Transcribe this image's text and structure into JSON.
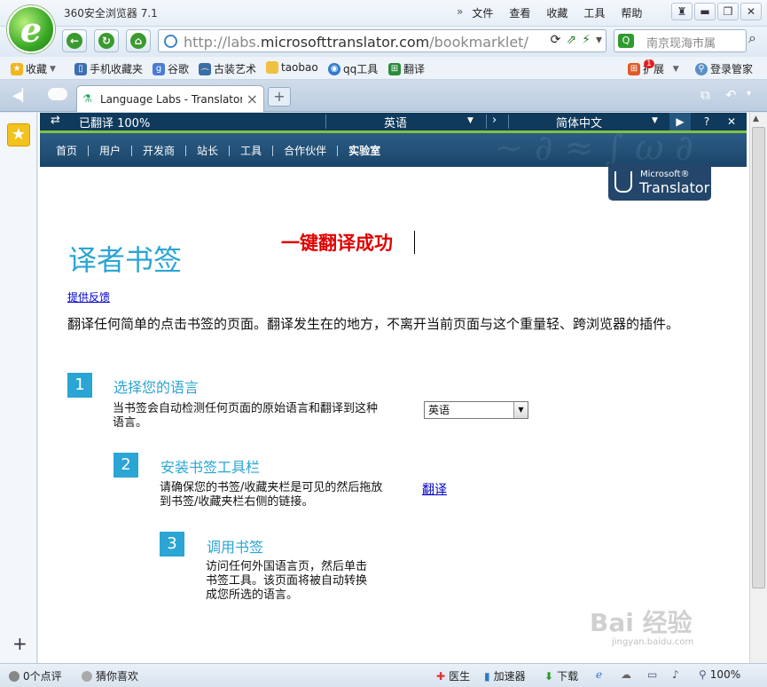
{
  "browser": {
    "title": "360安全浏览器 7.1",
    "menus": [
      "文件",
      "查看",
      "收藏",
      "工具",
      "帮助"
    ],
    "url_prefix": "http://labs.",
    "url_domain": "microsofttranslator.com",
    "url_path": "/bookmarklet/",
    "search_placeholder": "南京现海市属",
    "logo_letter": "e"
  },
  "bookmarks": {
    "favorites": "收藏",
    "mobile": "手机收藏夹",
    "google": "谷歌",
    "guzhuang": "古装艺术",
    "taobao": "taobao",
    "qq": "qq工具",
    "translate": "翻译",
    "extend": "扩展",
    "extend_badge": "1",
    "login": "登录管家"
  },
  "tab": {
    "label": "Language Labs - Translator"
  },
  "translator_bar": {
    "status": "已翻译 100%",
    "from_lang": "英语",
    "to_lang": "简体中文",
    "help": "?",
    "close": "✕"
  },
  "site_nav": [
    "首页",
    "用户",
    "开发商",
    "站长",
    "工具",
    "合作伙伴",
    "实验室"
  ],
  "badge": {
    "ms": "Microsoft®",
    "tr": "Translator"
  },
  "content": {
    "title": "译者书签",
    "annotation": "一键翻译成功",
    "feedback": "提供反馈",
    "intro": "翻译任何简单的点击书签的页面。翻译发生在的地方，不离开当前页面与这个重量轻、跨浏览器的插件。",
    "steps": [
      {
        "num": "1",
        "title": "选择您的语言",
        "desc": "当书签会自动检测任何页面的原始语言和翻译到这种语言。"
      },
      {
        "num": "2",
        "title": "安装书签工具栏",
        "desc": "请确保您的书签/收藏夹栏是可见的然后拖放到书签/收藏夹栏右侧的链接。"
      },
      {
        "num": "3",
        "title": "调用书签",
        "desc": "访问任何外国语言页，然后单击书签工具。该页面将被自动转换成您所选的语言。"
      }
    ],
    "language_select": "英语",
    "bookmark_link": "翻译"
  },
  "status": {
    "comments": "0个点评",
    "guess": "猜你喜欢",
    "doctor": "医生",
    "accelerator": "加速器",
    "download": "下载",
    "zoom": "100%"
  },
  "watermark": {
    "main": "Bai 经验",
    "sub": "jingyan.baidu.com"
  }
}
